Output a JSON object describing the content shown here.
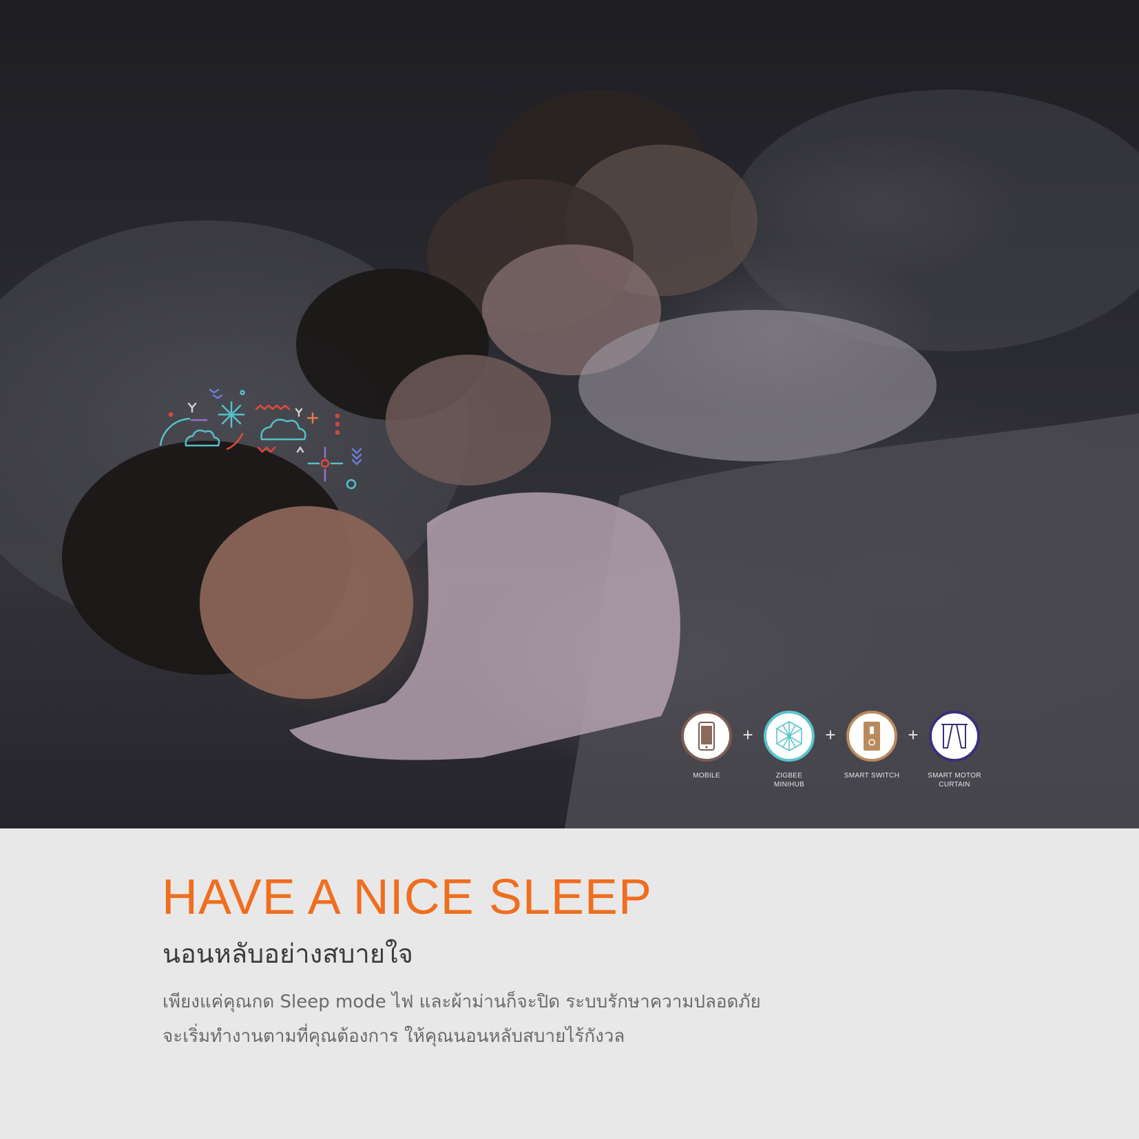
{
  "colors": {
    "accent_orange": "#f06e1e",
    "subhead_gray": "#3c3c3c",
    "body_gray": "#6a6a6a",
    "panel_bg": "#e9e8e9",
    "mobile_ring": "#7a5c52",
    "hub_ring": "#59c4cc",
    "switch_ring": "#b98a5e",
    "curtain_ring": "#3b2f7a"
  },
  "hero": {
    "scene_icons": [
      "sparkle-icon",
      "cloud-icon",
      "wave-icon",
      "fan-icon",
      "sun-icon",
      "arrow-down-icon",
      "dots-icon"
    ]
  },
  "products": [
    {
      "icon": "mobile-icon",
      "label_lines": [
        "MOBILE"
      ]
    },
    {
      "icon": "zigbee-hub-icon",
      "label_lines": [
        "ZIGBEE",
        "MINIHUB"
      ]
    },
    {
      "icon": "smart-switch-icon",
      "label_lines": [
        "SMART SWITCH"
      ]
    },
    {
      "icon": "curtain-icon",
      "label_lines": [
        "SMART MOTOR",
        "CURTAIN"
      ]
    }
  ],
  "plus_symbol": "+",
  "headline": "HAVE A NICE SLEEP",
  "subheadline": "นอนหลับอย่างสบายใจ",
  "body_lines": [
    "เพียงแค่คุณกด Sleep mode ไฟ และผ้าม่านก็จะปิด ระบบรักษาความปลอดภัย",
    "จะเริ่มทำงานตามที่คุณต้องการ ให้คุณนอนหลับสบายไร้กังวล"
  ]
}
